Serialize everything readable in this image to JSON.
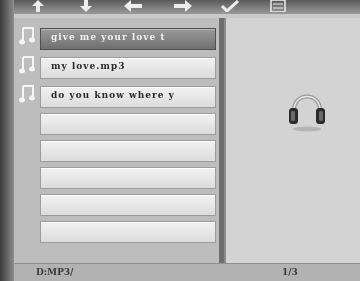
{
  "toolbar": {
    "icons": [
      "up-arrow-icon",
      "down-arrow-icon",
      "left-arrow-icon",
      "right-arrow-icon",
      "checkmark-icon",
      "list-icon"
    ]
  },
  "file_list": {
    "items": [
      {
        "label": "give me your love t",
        "type": "music",
        "selected": true
      },
      {
        "label": "my love.mp3",
        "type": "music",
        "selected": false
      },
      {
        "label": "do you know where y",
        "type": "music",
        "selected": false
      },
      {
        "label": "",
        "type": "empty",
        "selected": false
      },
      {
        "label": "",
        "type": "empty",
        "selected": false
      },
      {
        "label": "",
        "type": "empty",
        "selected": false
      },
      {
        "label": "",
        "type": "empty",
        "selected": false
      },
      {
        "label": "",
        "type": "empty",
        "selected": false
      }
    ]
  },
  "status": {
    "path": "D:MP3/",
    "page": "1/3"
  },
  "preview": {
    "icon": "headphones-icon"
  }
}
